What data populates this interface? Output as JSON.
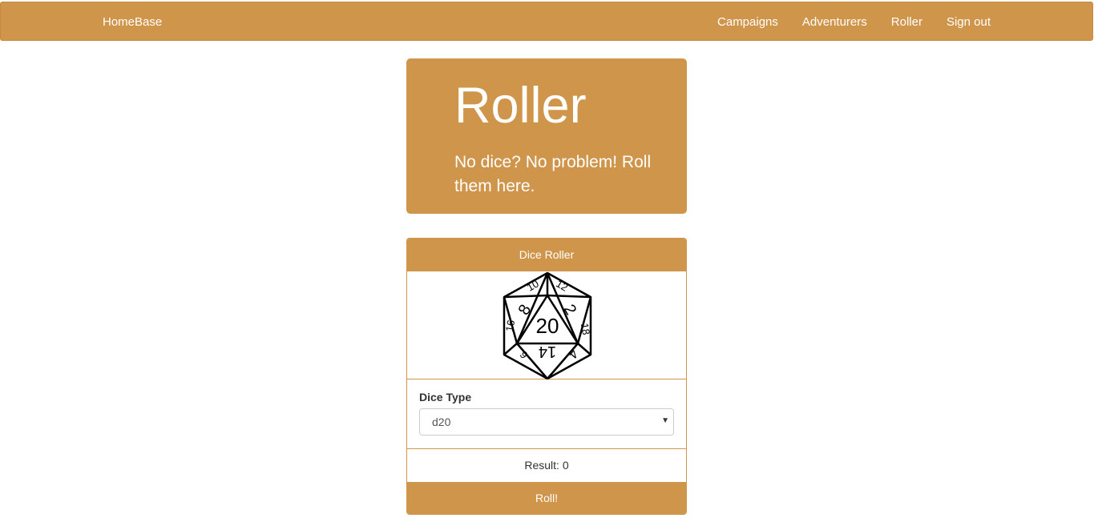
{
  "navbar": {
    "brand": "HomeBase",
    "links": [
      "Campaigns",
      "Adventurers",
      "Roller",
      "Sign out"
    ]
  },
  "jumbotron": {
    "title": "Roller",
    "subtitle": "No dice? No problem! Roll them here."
  },
  "panel": {
    "heading": "Dice Roller",
    "die_icon": "d20-icon",
    "die_numbers": [
      "20",
      "8",
      "2",
      "14",
      "10",
      "12",
      "16",
      "18",
      "6",
      "4"
    ],
    "dice_type_label": "Dice Type",
    "dice_type_selected": "d20",
    "result_text": "Result: 0",
    "roll_label": "Roll!"
  },
  "colors": {
    "accent": "#cf954b",
    "text": "#333333"
  }
}
